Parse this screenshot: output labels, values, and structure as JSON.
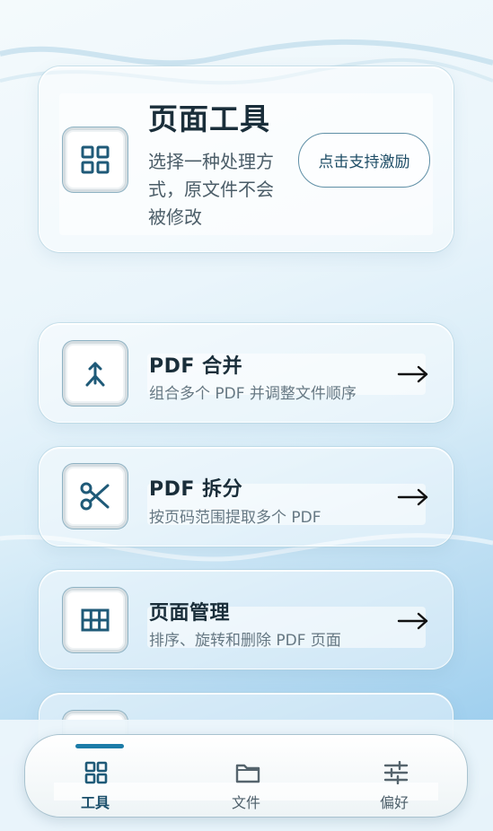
{
  "header": {
    "title": "页面工具",
    "description": "选择一种处理方式，原文件不会被修改",
    "support_button": "点击支持激励"
  },
  "tools": [
    {
      "title": "PDF 合并",
      "description": "组合多个 PDF 并调整文件顺序",
      "icon": "merge-icon"
    },
    {
      "title": "PDF 拆分",
      "description": "按页码范围提取多个 PDF",
      "icon": "scissors-icon"
    },
    {
      "title": "页面管理",
      "description": "排序、旋转和删除 PDF 页面",
      "icon": "table-grid-icon"
    }
  ],
  "nav": {
    "items": [
      {
        "label": "工具",
        "icon": "grid-icon",
        "active": true
      },
      {
        "label": "文件",
        "icon": "folder-icon",
        "active": false
      },
      {
        "label": "偏好",
        "icon": "sliders-icon",
        "active": false
      }
    ]
  },
  "colors": {
    "accent": "#1c7ca8",
    "icon": "#1f5a78",
    "title": "#1a2e3a"
  }
}
